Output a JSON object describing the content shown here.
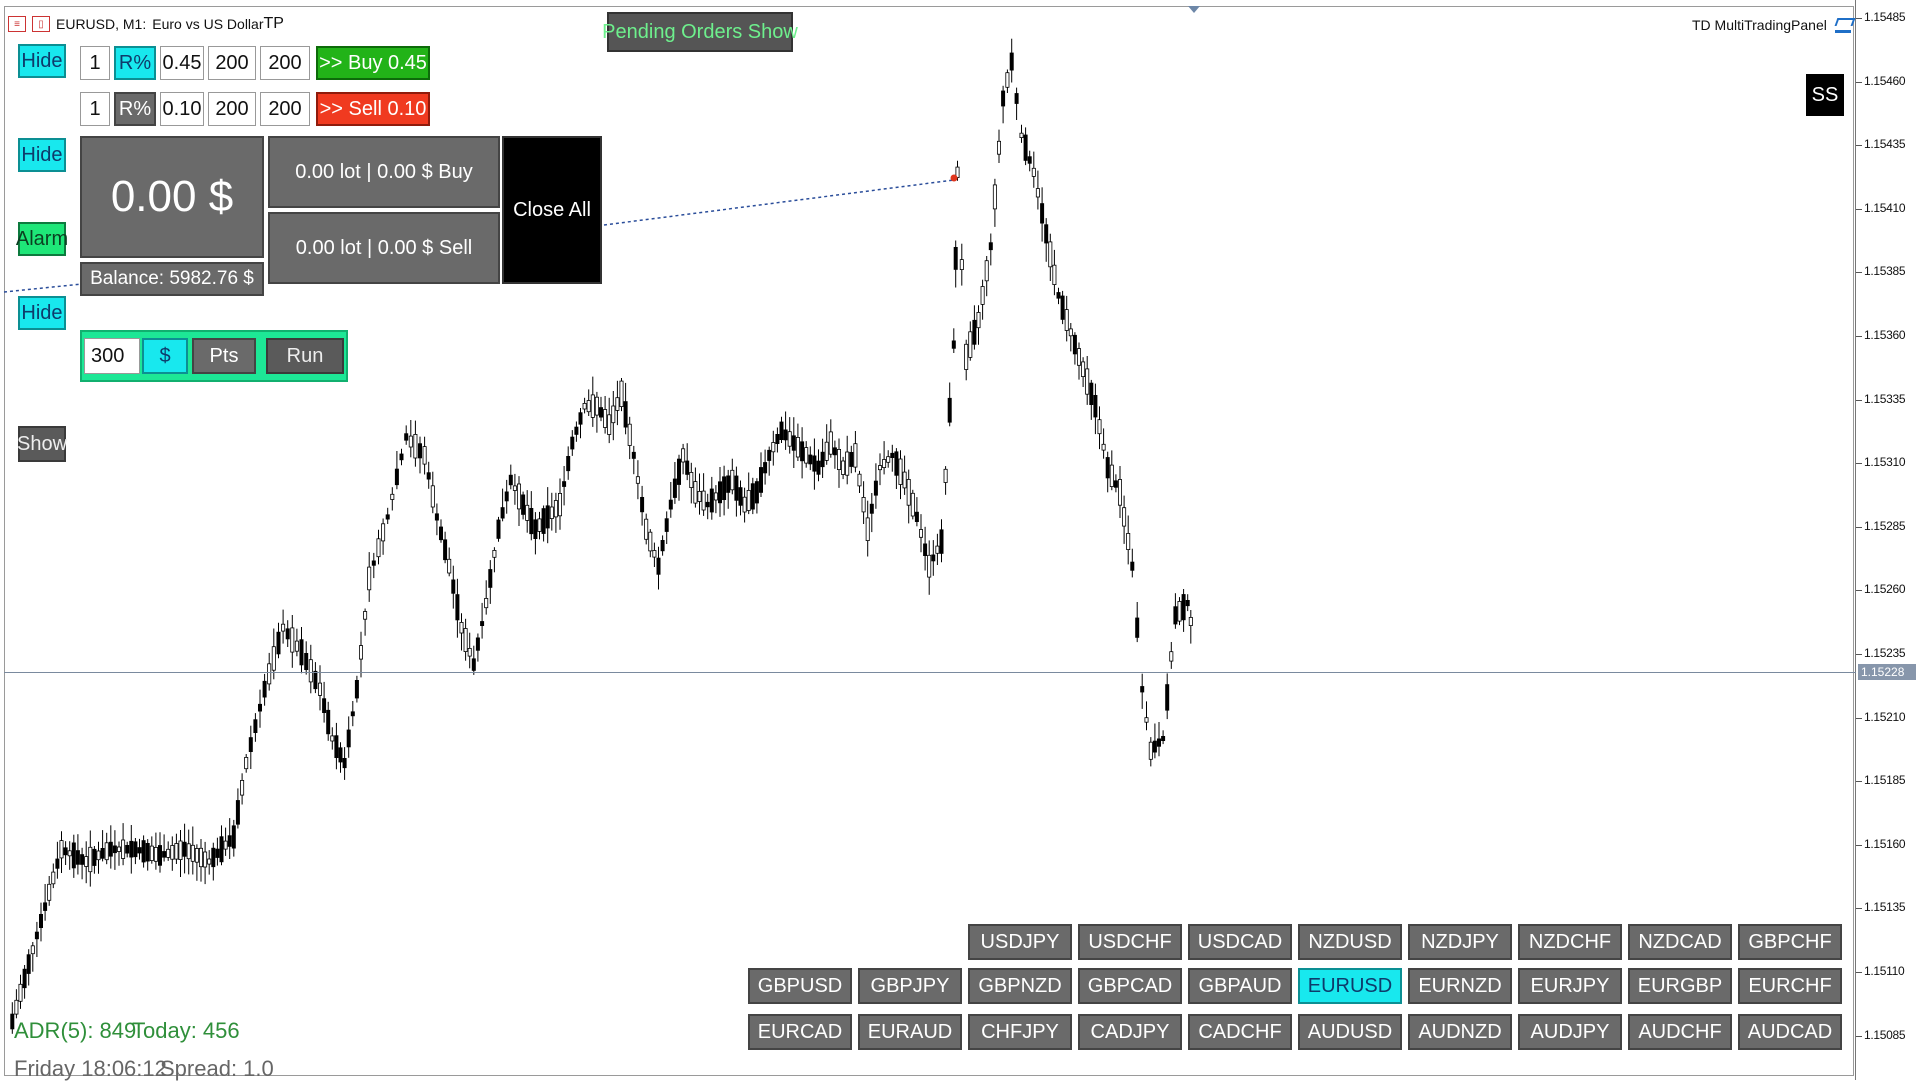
{
  "window": {
    "title_prefix": "EURUSD, M1:",
    "title_desc": "Euro vs US Dollar",
    "tp_mark": "TP"
  },
  "panel": {
    "name": "TD MultiTradingPanel",
    "ss_label": "SS",
    "pending_orders_label": "Pending Orders Show",
    "hide_label": "Hide",
    "alarm_label": "Alarm",
    "show_label": "Show",
    "buy_row": {
      "multiplier": "1",
      "mode": "R%",
      "lot": "0.45",
      "sl": "200",
      "tp": "200",
      "action": ">> Buy 0.45"
    },
    "sell_row": {
      "multiplier": "1",
      "mode": "R%",
      "lot": "0.10",
      "sl": "200",
      "tp": "200",
      "action": ">> Sell 0.10"
    },
    "profit": "0.00 $",
    "buy_summary": "0.00 lot | 0.00 $ Buy",
    "sell_summary": "0.00 lot | 0.00 $ Sell",
    "close_all": "Close All",
    "balance": "Balance: 5982.76 $",
    "target_value": "300",
    "currency_btn": "$",
    "points_btn": "Pts",
    "run_btn": "Run"
  },
  "stats": {
    "adr": "ADR(5): 849",
    "today": "Today: 456",
    "time": "Friday 18:06:12",
    "spread": "Spread: 1.0"
  },
  "price_scale": {
    "ticks": [
      "1.15485",
      "1.15460",
      "1.15435",
      "1.15410",
      "1.15385",
      "1.15360",
      "1.15335",
      "1.15310",
      "1.15285",
      "1.15260",
      "1.15235",
      "1.15210",
      "1.15185",
      "1.15160",
      "1.15135",
      "1.15110",
      "1.15085"
    ],
    "current_price": "1.15228"
  },
  "symbols": {
    "row1": [
      "USDJPY",
      "USDCHF",
      "USDCAD",
      "NZDUSD",
      "NZDJPY",
      "NZDCHF",
      "NZDCAD",
      "GBPCHF"
    ],
    "row2": [
      "GBPUSD",
      "GBPJPY",
      "GBPNZD",
      "GBPCAD",
      "GBPAUD",
      "EURUSD",
      "EURNZD",
      "EURJPY",
      "EURGBP",
      "EURCHF"
    ],
    "row3": [
      "EURCAD",
      "EURAUD",
      "CHFJPY",
      "CADJPY",
      "CADCHF",
      "AUDUSD",
      "AUDNZD",
      "AUDJPY",
      "AUDCHF",
      "AUDCAD"
    ],
    "active": "EURUSD"
  },
  "colors": {
    "accent_cyan": "#18e8ee",
    "buy_green": "#22b318",
    "sell_red": "#f03a20",
    "alarm_green": "#1ee678",
    "adr_green": "#2f8f3a"
  }
}
